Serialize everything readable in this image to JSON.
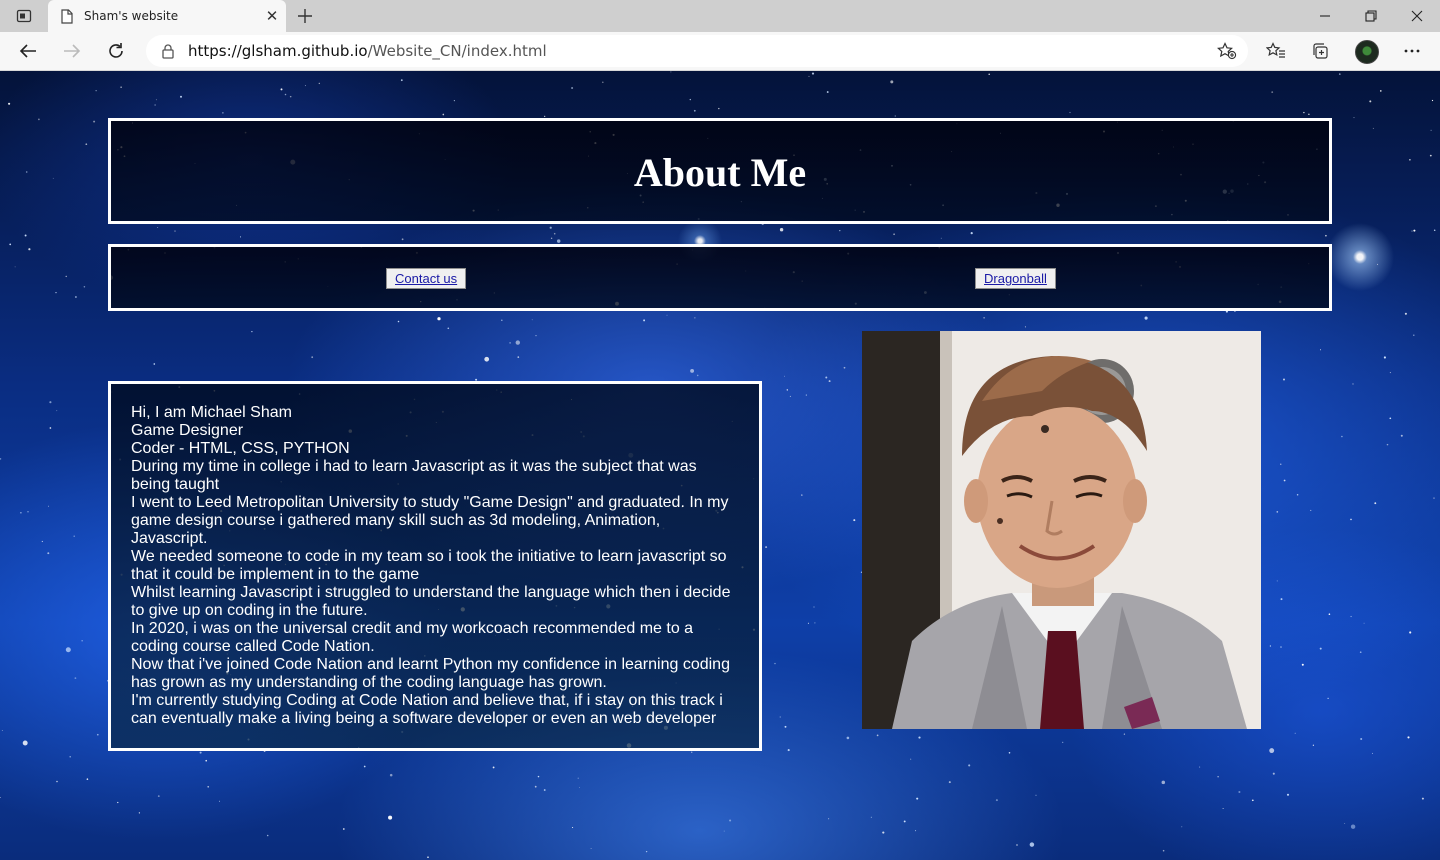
{
  "browser": {
    "tab_title": "Sham's website",
    "url_host": "https://glsham.github.io",
    "url_path": "/Website_CN/index.html"
  },
  "page": {
    "title": "About Me",
    "nav": [
      {
        "label": "Contact us"
      },
      {
        "label": "Dragonball"
      }
    ],
    "bio_lines": [
      "Hi, I am Michael Sham",
      "Game Designer",
      "Coder - HTML, CSS, PYTHON",
      "During my time in college i had to learn Javascript as it was the subject that was",
      "being taught",
      "I went to Leed Metropolitan University to study \"Game Design\" and graduated. In my",
      "game design course i gathered many skill such as 3d modeling, Animation,",
      "Javascript.",
      "We needed someone to code in my team so i took the initiative to learn javascript so",
      "that it could be implement in to the game",
      "Whilst learning Javascript i struggled to understand the language which then i decide",
      "to give up on coding in the future.",
      "In 2020, i was on the universal credit and my workcoach recommended me to a",
      "coding course called Code Nation.",
      "Now that i've joined Code Nation and learnt Python my confidence in learning coding",
      "has grown as my understanding of the coding language has grown.",
      "I'm currently studying Coding at Code Nation and believe that, if i stay on this track i",
      "can eventually make a living being a software developer or even an web developer"
    ]
  },
  "colors": {
    "border": "#ffffff",
    "link": "#1a1aa6",
    "space_blue": "#0e3fa8"
  }
}
